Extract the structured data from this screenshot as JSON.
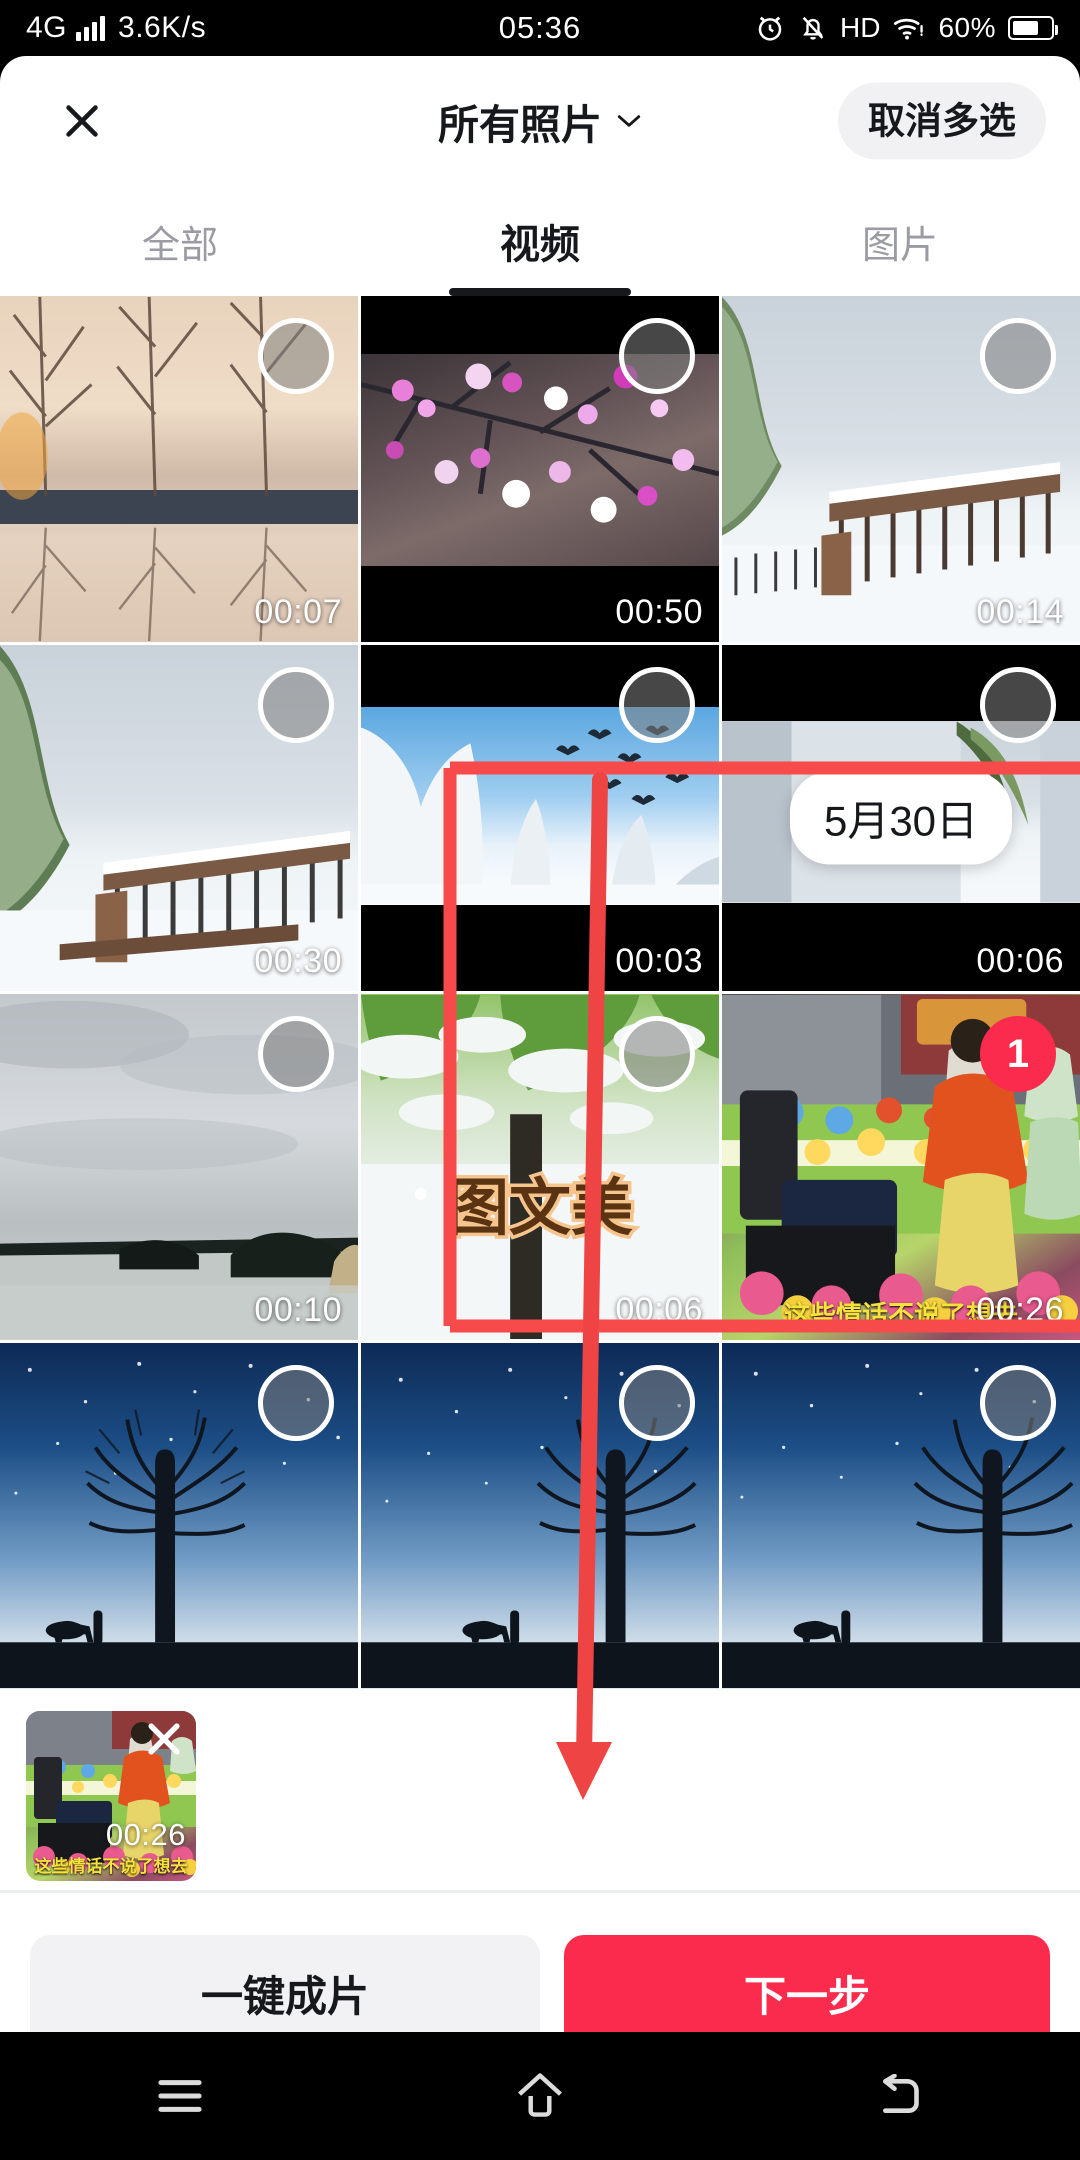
{
  "status_bar": {
    "network": "4G",
    "speed": "3.6K/s",
    "time": "05:36",
    "hd": "HD",
    "battery_percent": "60%",
    "icons": [
      "signal-bars-icon",
      "alarm-clock-icon",
      "bell-muted-icon",
      "wifi-icon",
      "battery-icon"
    ]
  },
  "header": {
    "close_icon": "close-icon",
    "title": "所有照片",
    "chevron_icon": "chevron-down-icon",
    "cancel_multiselect": "取消多选"
  },
  "tabs": [
    {
      "label": "全部",
      "active": false
    },
    {
      "label": "视频",
      "active": true
    },
    {
      "label": "图片",
      "active": false
    }
  ],
  "grid": {
    "date_chip": "5月30日",
    "watermark": "图文美",
    "subtitle": "这些情话不说了想去",
    "items": [
      {
        "duration": "00:07",
        "scene": "sunset-trees-reflection",
        "selected": false
      },
      {
        "duration": "00:50",
        "scene": "pink-blossom-branches",
        "selected": false
      },
      {
        "duration": "00:14",
        "scene": "snowy-wooden-fence",
        "selected": false
      },
      {
        "duration": "00:30",
        "scene": "snowy-fence-pine",
        "selected": false
      },
      {
        "duration": "00:03",
        "scene": "frost-trees-flying-birds",
        "selected": false
      },
      {
        "duration": "00:06",
        "scene": "snow-scene-date-overlay",
        "selected": false
      },
      {
        "duration": "00:10",
        "scene": "lake-cloudy-sky",
        "selected": false
      },
      {
        "duration": "00:06",
        "scene": "snow-covered-green-tree",
        "selected": false
      },
      {
        "duration": "00:26",
        "scene": "stage-performance-red-dress",
        "selected": true,
        "badge": "1"
      },
      {
        "duration": "",
        "scene": "starry-night-tree-horse",
        "selected": false
      },
      {
        "duration": "",
        "scene": "starry-night-tree-horse",
        "selected": false
      },
      {
        "duration": "",
        "scene": "starry-night-tree-horse",
        "selected": false
      }
    ]
  },
  "selected_strip": {
    "thumb_duration": "00:26",
    "thumb_subtitle": "这些情话不说了想去",
    "remove_icon": "close-icon"
  },
  "bottom_bar": {
    "secondary_label": "一键成片",
    "primary_label": "下一步"
  },
  "nav_bar": {
    "icons": [
      "menu-icon",
      "home-icon",
      "back-icon"
    ]
  },
  "annotation": {
    "color": "#f74b4b",
    "shapes": [
      "highlight-rectangle",
      "down-arrow"
    ]
  },
  "colors": {
    "accent": "#fb2b4e",
    "annotation": "#f74b4b",
    "text_primary": "#16181c",
    "text_muted": "#9b9ba3",
    "chip_bg": "#f1f1f3"
  }
}
